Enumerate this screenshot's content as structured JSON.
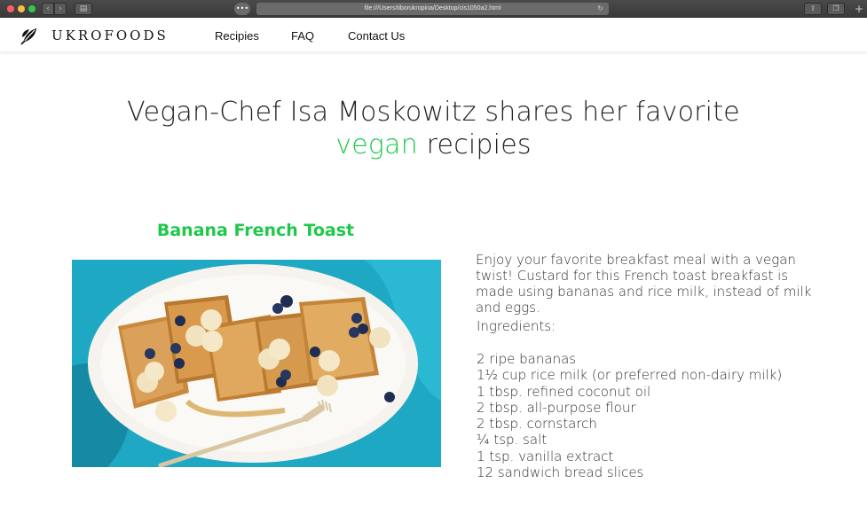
{
  "browser": {
    "url": "file:///Users/tiborukropina/Desktop/cis1050a2.html",
    "chat_bubble": "•••"
  },
  "site": {
    "brand": "UKROFOODS",
    "nav": [
      "Recipies",
      "FAQ",
      "Contact Us"
    ]
  },
  "hero": {
    "line1": "Vegan-Chef Isa Moskowitz shares her favorite",
    "accent": "vegan",
    "rest": " recipies"
  },
  "recipe": {
    "title": "Banana French Toast",
    "description": "Enjoy your favorite breakfast meal with a  vegan twist! Custard for this French toast breakfast is made using bananas and rice milk, instead of milk and eggs.",
    "ingredients_heading": "Ingredients:",
    "ingredients": [
      "2 ripe bananas",
      "1½ cup rice milk (or preferred non-dairy milk)",
      "1 tbsp. refined coconut oil",
      "2 tbsp. all-purpose flour",
      "2 tbsp. cornstarch",
      "¼ tsp. salt",
      "1 tsp. vanilla extract",
      "12 sandwich bread slices"
    ]
  },
  "colors": {
    "accent_green": "#1ec84a",
    "tablecloth": "#1fa8c4",
    "plate": "#f6f3ee",
    "toast": "#c98a3e"
  }
}
